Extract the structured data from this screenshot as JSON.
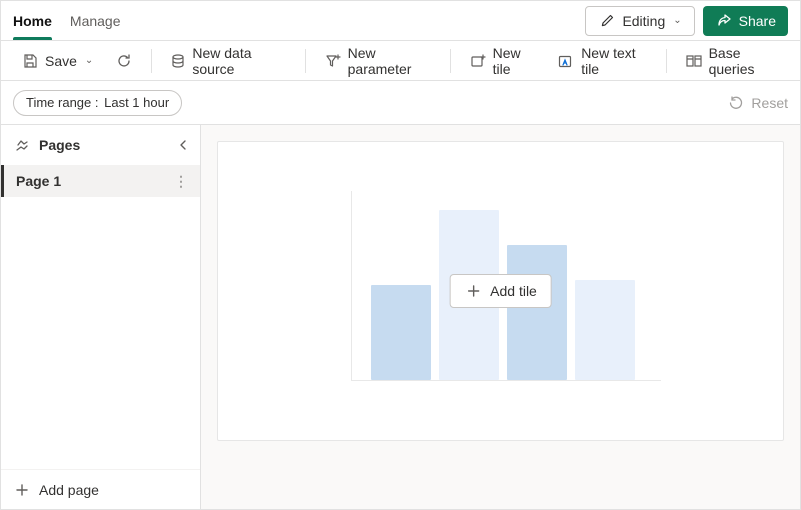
{
  "tabs": {
    "home": "Home",
    "manage": "Manage"
  },
  "header": {
    "editing_label": "Editing",
    "share_label": "Share"
  },
  "toolbar": {
    "save": "Save",
    "new_data_source": "New data source",
    "new_parameter": "New parameter",
    "new_tile": "New tile",
    "new_text_tile": "New text tile",
    "base_queries": "Base queries"
  },
  "filter": {
    "time_range_label": "Time range :",
    "time_range_value": "Last 1 hour",
    "reset": "Reset"
  },
  "sidebar": {
    "title": "Pages",
    "pages": [
      {
        "name": "Page 1"
      }
    ],
    "add_page": "Add page"
  },
  "canvas": {
    "add_tile": "Add tile"
  },
  "chart_data": {
    "type": "bar",
    "categories": [
      "",
      "",
      "",
      ""
    ],
    "values": [
      95,
      170,
      135,
      100
    ],
    "title": "",
    "xlabel": "",
    "ylabel": "",
    "note": "decorative placeholder chart with no axis labels or numeric ticks visible"
  }
}
